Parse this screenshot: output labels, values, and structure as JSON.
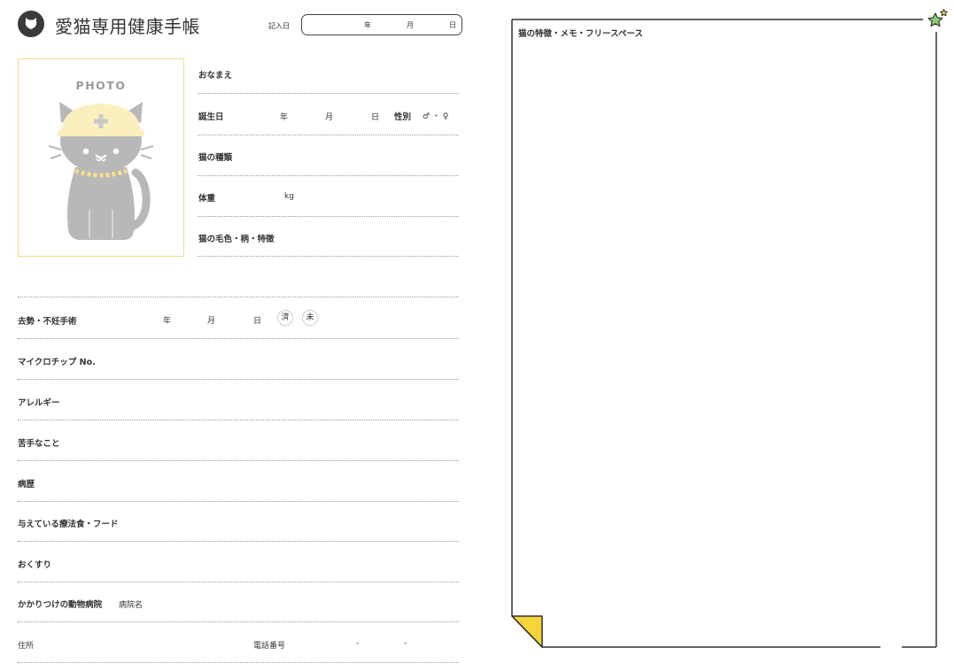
{
  "header": {
    "title": "愛猫専用健康手帳",
    "entry_date_label": "記入日",
    "year": "年",
    "month": "月",
    "day": "日"
  },
  "photo": {
    "label": "PHOTO"
  },
  "profile": {
    "name": "おなまえ",
    "birthday": "誕生日",
    "birth_year": "年",
    "birth_month": "月",
    "birth_day": "日",
    "sex_label": "性別",
    "sex_options": "♂ ・ ♀",
    "breed": "猫の種類",
    "weight": "体重",
    "weight_unit": "kg",
    "coat": "猫の毛色・柄・特徴"
  },
  "records": {
    "neuter": "去勢・不妊手術",
    "neuter_year": "年",
    "neuter_month": "月",
    "neuter_day": "日",
    "done": "済",
    "not_done": "未",
    "microchip": "マイクロチップ No.",
    "allergy": "アレルギー",
    "dislikes": "苦手なこと",
    "history": "病歴",
    "food": "与えている療法食・フード",
    "medicine": "おくすり",
    "clinic": "かかりつけの動物病院",
    "clinic_name": "病院名",
    "address": "住所",
    "phone": "電話番号",
    "phone_sep1": "-",
    "phone_sep2": "-"
  },
  "memo": {
    "title": "猫の特徴・メモ・フリースペース"
  },
  "colors": {
    "accent_yellow": "#f5d33a",
    "photo_border": "#f1dc8a",
    "star_green": "#8fcf72",
    "ink": "#333333",
    "cat_gray": "#b8b8b8"
  }
}
